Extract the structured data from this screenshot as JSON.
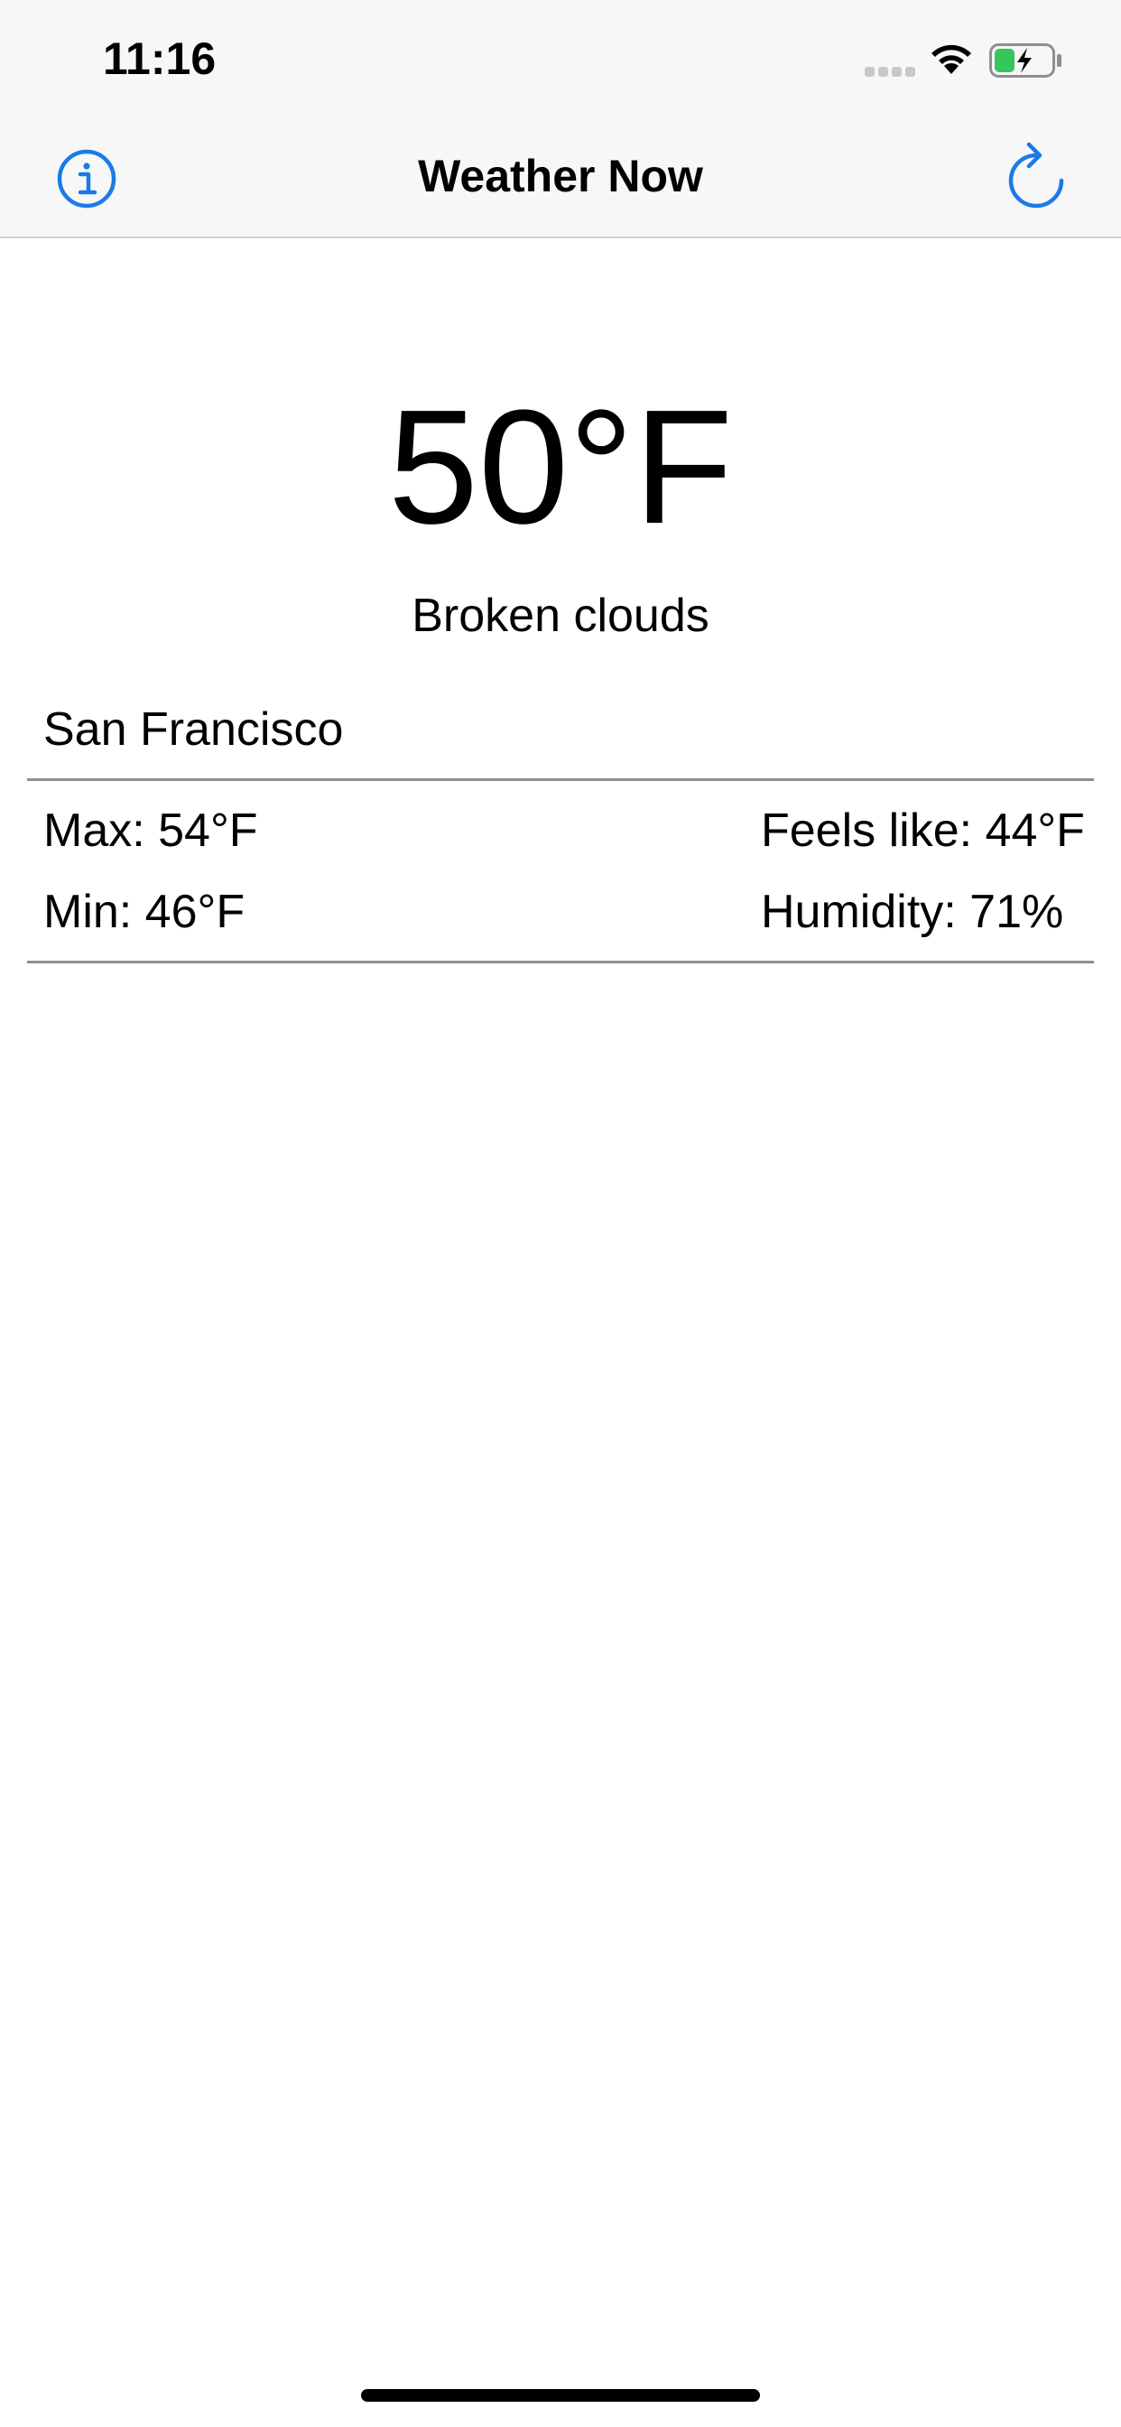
{
  "status_bar": {
    "time": "11:16",
    "icons": [
      "cellular-signal-icon",
      "wifi-icon",
      "battery-charging-icon"
    ]
  },
  "nav": {
    "title": "Weather Now",
    "left_icon": "info-icon",
    "right_icon": "refresh-icon"
  },
  "weather": {
    "temperature": "50°F",
    "condition": "Broken clouds",
    "city": "San Francisco",
    "max": "Max: 54°F",
    "min": "Min: 46°F",
    "feels_like": "Feels like: 44°F",
    "humidity": "Humidity: 71%"
  },
  "colors": {
    "accent": "#1a7ae8",
    "bar_background": "#f7f7f7",
    "divider": "#8e8e93",
    "battery_fill": "#34c759"
  }
}
